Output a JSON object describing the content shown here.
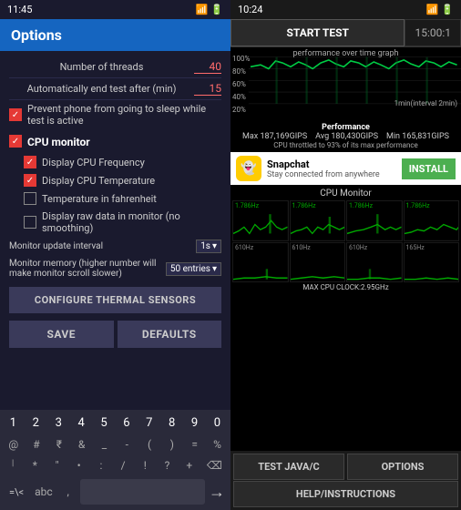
{
  "left": {
    "statusBar": {
      "time": "11:45",
      "icons": [
        "signal",
        "wifi",
        "battery"
      ]
    },
    "header": "Options",
    "settings": {
      "threads_label": "Number of threads",
      "threads_value": "40",
      "auto_end_label": "Automatically end test after (min)",
      "auto_end_value": "15"
    },
    "checkboxes": [
      {
        "id": "sleep",
        "checked": true,
        "label": "Prevent phone from going to sleep while test is active"
      },
      {
        "id": "cpu_monitor",
        "checked": true,
        "label": "CPU monitor"
      },
      {
        "id": "cpu_freq",
        "checked": true,
        "label": "Display CPU Frequency"
      },
      {
        "id": "cpu_temp",
        "checked": true,
        "label": "Display CPU Temperature"
      },
      {
        "id": "fahrenheit",
        "checked": false,
        "label": "Temperature in fahrenheit"
      },
      {
        "id": "raw_data",
        "checked": false,
        "label": "Display raw data in monitor (no smoothing)"
      }
    ],
    "monitor_interval_label": "Monitor update interval",
    "monitor_interval_value": "1s",
    "monitor_memory_label": "Monitor memory (higher number will make monitor scroll slower)",
    "monitor_memory_value": "50 entries",
    "configure_btn": "CONFIGURE THERMAL SENSORS",
    "save_btn": "SAVE",
    "defaults_btn": "DEFAULTS"
  },
  "keyboard": {
    "row1": [
      "1",
      "2",
      "3",
      "4",
      "5",
      "6",
      "7",
      "8",
      "9",
      "0"
    ],
    "row2": [
      "@",
      "#",
      "₹",
      "&",
      "_",
      "-",
      "(",
      ")",
      ",",
      "%"
    ],
    "row3": [
      "|",
      "*",
      "'",
      "•",
      ":",
      "/",
      "!",
      "?",
      "+",
      "⌫"
    ],
    "mode": "=\\<",
    "abc": "abc",
    "comma": ",",
    "space": "",
    "enter": "→"
  },
  "right": {
    "statusBar": {
      "time": "10:24",
      "icons": [
        "signal",
        "wifi",
        "battery"
      ]
    },
    "tabs": {
      "start": "START TEST",
      "time": "15:00:1"
    },
    "chart": {
      "title": "performance over time graph",
      "y_labels": [
        "100%",
        "80%",
        "60%",
        "40%",
        "20%"
      ],
      "x_label": "1min(interval 2min)"
    },
    "performance": {
      "label": "Performance",
      "max": "Max 187,169GIPS",
      "avg": "Avg 180,430GIPS",
      "min": "Min 165,831GIPS",
      "throttle": "CPU throttled to 93% of its max performance"
    },
    "ad": {
      "name": "Snapchat",
      "sub": "Stay connected from anywhere",
      "btn": "INSTALL"
    },
    "cpu_monitor": {
      "title": "CPU Monitor",
      "cells": [
        {
          "label": "1.786Hz"
        },
        {
          "label": "1.786Hz"
        },
        {
          "label": "1.786Hz"
        },
        {
          "label": "1.786Hz"
        },
        {
          "label": "610Hz"
        },
        {
          "label": "610Hz"
        },
        {
          "label": "610Hz"
        },
        {
          "label": "165Hz"
        }
      ],
      "max_clock": "MAX CPU CLOCK:2.95GHz"
    },
    "nav": {
      "test_java": "TEST JAVA/C",
      "options": "OPTIONS",
      "help": "HELP/INSTRUCTIONS"
    }
  }
}
